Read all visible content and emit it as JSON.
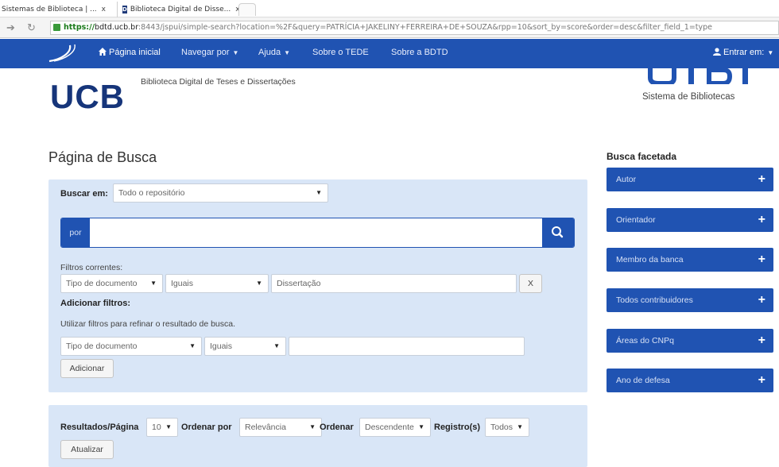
{
  "browser": {
    "tab1_title": "Sistemas de Biblioteca | ...",
    "tab1_close": "x",
    "tab2_title": "Biblioteca Digital de Disse...",
    "tab2_close": "x",
    "url_scheme": "https://",
    "url_host": "bdtd.ucb.br",
    "url_rest": ":8443/jspui/simple-search?location=%2F&query=PATRÍCIA+JAKELINY+FERREIRA+DE+SOUZA&rpp=10&sort_by=score&order=desc&filter_field_1=type"
  },
  "navbar": {
    "home": "Página inicial",
    "browse": "Navegar por",
    "help": "Ajuda",
    "about_tede": "Sobre o TEDE",
    "about_bdtd": "Sobre a BDTD",
    "login": "Entrar em:"
  },
  "header": {
    "logo_text": "UCB",
    "subtitle": "Biblioteca Digital de Teses e Dissertações",
    "right_caption": "Sistema de Bibliotecas"
  },
  "page_title": "Página de Busca",
  "search": {
    "scope_label": "Buscar em:",
    "scope_value": "Todo o repositório",
    "prefix": "por",
    "query_value": "",
    "current_filters_label": "Filtros correntes:",
    "current_filter": {
      "field": "Tipo de documento",
      "operator": "Iguais",
      "value": "Dissertação",
      "remove": "X"
    },
    "add_filters_label": "Adicionar filtros:",
    "add_filters_help": "Utilizar filtros para refinar o resultado de busca.",
    "new_filter": {
      "field": "Tipo de documento",
      "operator": "Iguais",
      "value": ""
    },
    "add_button": "Adicionar"
  },
  "results": {
    "per_page_label": "Resultados/Página",
    "per_page_value": "10",
    "sort_by_label": "Ordenar por",
    "sort_by_value": "Relevância",
    "order_label": "Ordenar",
    "order_value": "Descendente",
    "records_label": "Registro(s)",
    "records_value": "Todos",
    "update_button": "Atualizar"
  },
  "facets": {
    "title": "Busca facetada",
    "items": [
      "Autor",
      "Orientador",
      "Membro da banca",
      "Todos contribuidores",
      "Áreas do CNPq",
      "Ano de defesa"
    ]
  },
  "colors": {
    "primary": "#2053b2",
    "panel": "#d9e6f7",
    "logo": "#16357a"
  }
}
